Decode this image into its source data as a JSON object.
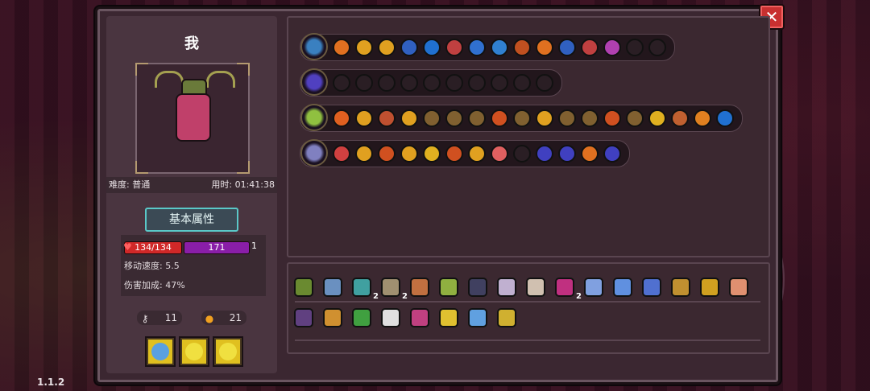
{
  "version": "1.1.2",
  "close_label": "✕",
  "player": {
    "name": "我",
    "difficulty": "难度: 普通",
    "time": "用时: 01:41:38",
    "tab_label": "基本属性",
    "hp": "134/134",
    "mp": "171",
    "mp_extra": "1",
    "move_speed": "移动速度: 5.5",
    "damage_bonus": "伤害加成: 47%",
    "keys": "11",
    "coins": "21"
  },
  "potions": [
    {
      "icon": "blue-flask-icon",
      "color": "#5aa0e0"
    },
    {
      "icon": "yellow-flask-icon",
      "color": "#f0e040"
    },
    {
      "icon": "yellow-flask-icon",
      "color": "#f0e040"
    }
  ],
  "weapon_rows": [
    {
      "weapon_icon": "chest-icon",
      "weapon_color": "#3a80c0",
      "slots": [
        "#e07020",
        "#e0a020",
        "#e0a020",
        "#3060c0",
        "#2070d0",
        "#c04040",
        "#3070d0",
        "#3080d0",
        "#c05020",
        "#e07020",
        "#3060c0",
        "#c04040",
        "#b040b0",
        "#2a1e24",
        "#2a1e24"
      ]
    },
    {
      "weapon_icon": "vortex-icon",
      "weapon_color": "#5040c0",
      "slots": [
        "#2a1e24",
        "#2a1e24",
        "#2a1e24",
        "#2a1e24",
        "#2a1e24",
        "#2a1e24",
        "#2a1e24",
        "#2a1e24",
        "#2a1e24",
        "#2a1e24"
      ]
    },
    {
      "weapon_icon": "staff-icon",
      "weapon_color": "#90c040",
      "slots": [
        "#e06020",
        "#e0a020",
        "#c05030",
        "#e0a020",
        "#806030",
        "#806030",
        "#806030",
        "#d05020",
        "#806030",
        "#e0a020",
        "#806030",
        "#806030",
        "#d05020",
        "#806030",
        "#e0b020",
        "#c06030",
        "#e08020",
        "#2070d0"
      ]
    },
    {
      "weapon_icon": "spear-icon",
      "weapon_color": "#8080c0",
      "slots": [
        "#d04040",
        "#e0a020",
        "#d05020",
        "#e0a020",
        "#e0b020",
        "#d05020",
        "#e0a020",
        "#e06060",
        "#2a1e24",
        "#4040c0",
        "#4040c0",
        "#e07020",
        "#4040c0"
      ]
    }
  ],
  "inventory_row1": [
    {
      "icon": "herb-icon",
      "color": "#6a8a30",
      "count": ""
    },
    {
      "icon": "scroll-icon",
      "color": "#6a90c0",
      "count": ""
    },
    {
      "icon": "map-icon",
      "color": "#40a0a0",
      "count": "2"
    },
    {
      "icon": "fish-icon",
      "color": "#a09070",
      "count": "2"
    },
    {
      "icon": "log-icon",
      "color": "#c07040",
      "count": ""
    },
    {
      "icon": "cricket-icon",
      "color": "#90b040",
      "count": ""
    },
    {
      "icon": "rock-icon",
      "color": "#404060",
      "count": ""
    },
    {
      "icon": "feather-icon",
      "color": "#c0b0d0",
      "count": ""
    },
    {
      "icon": "bone-icon",
      "color": "#d0c0b0",
      "count": ""
    },
    {
      "icon": "flower-icon",
      "color": "#c03080",
      "count": "2"
    },
    {
      "icon": "crystal-icon",
      "color": "#80a0e0",
      "count": ""
    },
    {
      "icon": "egg-icon",
      "color": "#6090e0",
      "count": ""
    },
    {
      "icon": "gem-icon",
      "color": "#5070d0",
      "count": ""
    },
    {
      "icon": "amulet-icon",
      "color": "#c09030",
      "count": ""
    },
    {
      "icon": "pickaxe-icon",
      "color": "#d0a020",
      "count": ""
    },
    {
      "icon": "meat-icon",
      "color": "#e09070",
      "count": ""
    }
  ],
  "inventory_row2": [
    {
      "icon": "bag-icon",
      "color": "#604080",
      "count": ""
    },
    {
      "icon": "card-icon",
      "color": "#d09030",
      "count": ""
    },
    {
      "icon": "pot-icon",
      "color": "#40a040",
      "count": ""
    },
    {
      "icon": "teeth-icon",
      "color": "#e0e0e0",
      "count": ""
    },
    {
      "icon": "shield-icon",
      "color": "#c04080",
      "count": ""
    },
    {
      "icon": "cup-icon",
      "color": "#e0c030",
      "count": ""
    },
    {
      "icon": "magnifier-icon",
      "color": "#60a0e0",
      "count": ""
    },
    {
      "icon": "worm-icon",
      "color": "#d0b030",
      "count": ""
    }
  ]
}
